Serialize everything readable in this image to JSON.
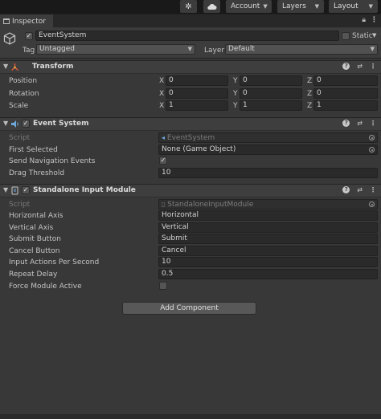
{
  "toolbar": {
    "account_label": "Account",
    "layers_label": "Layers",
    "layout_label": "Layout"
  },
  "tab": {
    "label": "Inspector"
  },
  "object": {
    "name": "EventSystem",
    "static_label": "Static",
    "tag_label": "Tag",
    "tag_value": "Untagged",
    "layer_label": "Layer",
    "layer_value": "Default"
  },
  "transform": {
    "title": "Transform",
    "rows": [
      {
        "label": "Position",
        "x": "0",
        "y": "0",
        "z": "0"
      },
      {
        "label": "Rotation",
        "x": "0",
        "y": "0",
        "z": "0"
      },
      {
        "label": "Scale",
        "x": "1",
        "y": "1",
        "z": "1"
      }
    ],
    "axis": {
      "x": "X",
      "y": "Y",
      "z": "Z"
    }
  },
  "event_system": {
    "title": "Event System",
    "script_label": "Script",
    "script_value": "EventSystem",
    "first_selected_label": "First Selected",
    "first_selected_value": "None (Game Object)",
    "send_nav_label": "Send Navigation Events",
    "send_nav_checked": true,
    "drag_threshold_label": "Drag Threshold",
    "drag_threshold_value": "10"
  },
  "standalone": {
    "title": "Standalone Input Module",
    "script_label": "Script",
    "script_value": "StandaloneInputModule",
    "rows": [
      {
        "label": "Horizontal Axis",
        "value": "Horizontal"
      },
      {
        "label": "Vertical Axis",
        "value": "Vertical"
      },
      {
        "label": "Submit Button",
        "value": "Submit"
      },
      {
        "label": "Cancel Button",
        "value": "Cancel"
      },
      {
        "label": "Input Actions Per Second",
        "value": "10"
      },
      {
        "label": "Repeat Delay",
        "value": "0.5"
      }
    ],
    "force_label": "Force Module Active",
    "force_checked": false
  },
  "add_component_label": "Add Component"
}
